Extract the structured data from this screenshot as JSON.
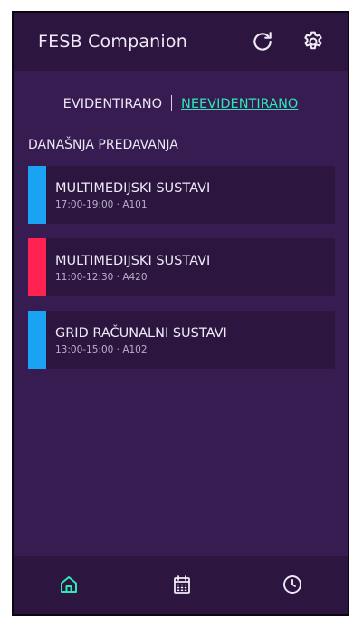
{
  "app": {
    "title": "FESB Companion"
  },
  "header_icons": {
    "refresh": "refresh-icon",
    "settings": "gear-icon"
  },
  "filter": {
    "option_recorded": "EVIDENTIRANO",
    "option_unrecorded": "NEEVIDENTIRANO",
    "active": "NEEVIDENTIRANO"
  },
  "section": {
    "title": "DANAŠNJA PREDAVANJA"
  },
  "lectures": [
    {
      "name": "MULTIMEDIJSKI SUSTAVI",
      "meta": "17:00-19:00 · A101",
      "color": "#1aa3f2"
    },
    {
      "name": "MULTIMEDIJSKI SUSTAVI",
      "meta": "11:00-12:30 · A420",
      "color": "#ff2150"
    },
    {
      "name": "GRID RAČUNALNI SUSTAVI",
      "meta": "13:00-15:00 · A102",
      "color": "#1aa3f2"
    }
  ],
  "bottom_nav": {
    "items": [
      {
        "icon": "home-icon",
        "active": true
      },
      {
        "icon": "calendar-icon",
        "active": false
      },
      {
        "icon": "clock-icon",
        "active": false
      }
    ]
  },
  "colors": {
    "background": "#371c52",
    "surface": "#2c1640",
    "accent": "#2ee6b8",
    "text": "#f0eaf6",
    "muted_text": "#b9aec8"
  }
}
